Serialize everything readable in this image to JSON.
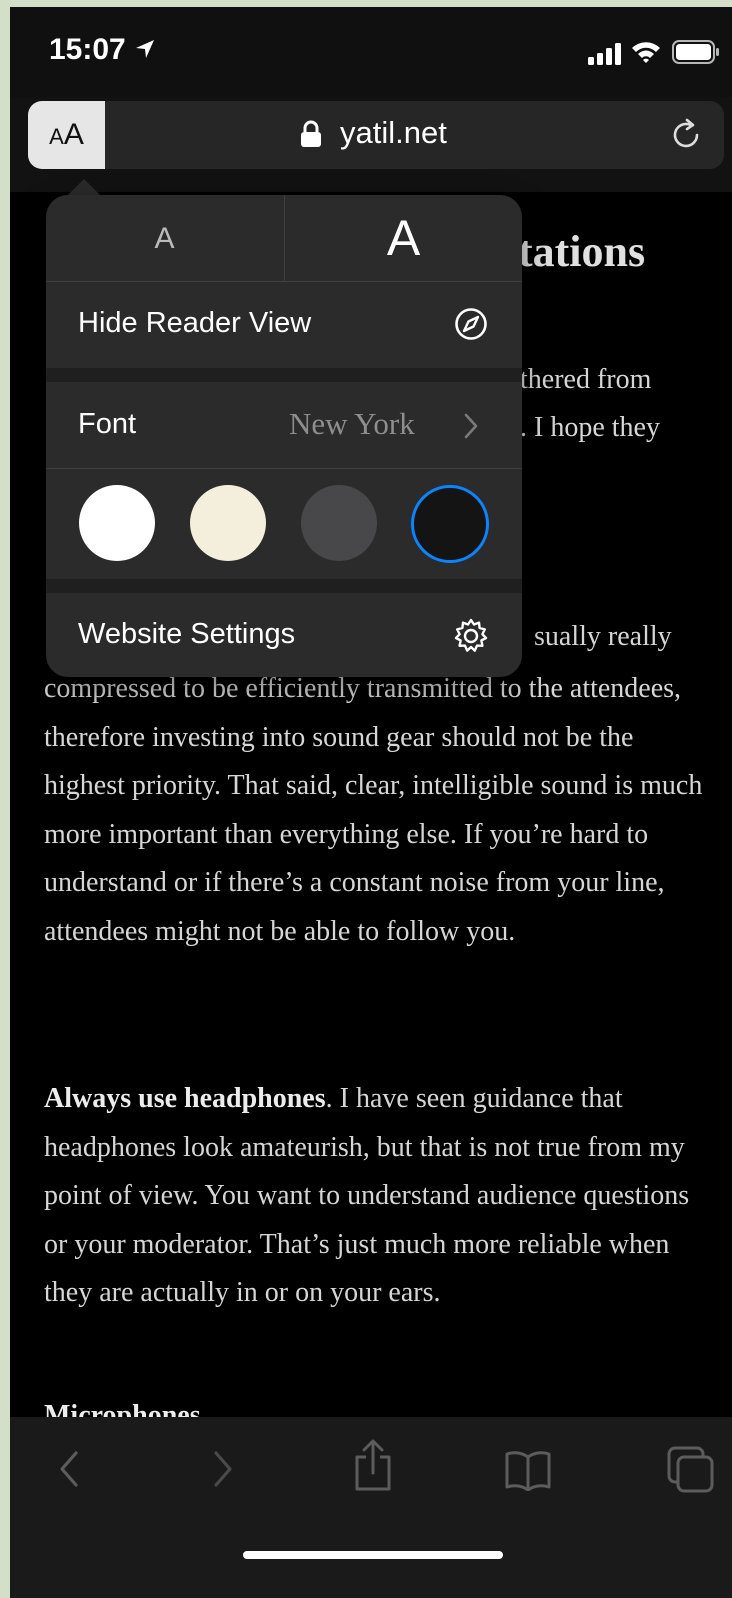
{
  "status_bar": {
    "time": "15:07",
    "icons": [
      "location-arrow-icon",
      "cellular-signal-icon",
      "wifi-icon",
      "battery-icon"
    ]
  },
  "address_bar": {
    "reader_button_label": "AA",
    "url": "yatil.net",
    "icons": [
      "lock-icon",
      "reload-icon"
    ]
  },
  "reader_popover": {
    "smaller_text_label": "A",
    "larger_text_label": "A",
    "hide_reader_view_label": "Hide Reader View",
    "font_label": "Font",
    "font_value": "New York",
    "themes": [
      {
        "name": "white",
        "color": "#ffffff",
        "selected": false
      },
      {
        "name": "sepia",
        "color": "#f4eedd",
        "selected": false
      },
      {
        "name": "gray",
        "color": "#48484b",
        "selected": false
      },
      {
        "name": "black",
        "color": "#141414",
        "selected": true
      }
    ],
    "selected_border_color": "#0a84ff",
    "website_settings_label": "Website Settings"
  },
  "article": {
    "title_fragment": "tations",
    "fragment_line_1": "thered from",
    "fragment_line_2": ". I hope they",
    "fragment_line_3": "sually really",
    "paragraph_1": "compressed to be efficiently transmitted to the attendees, therefore investing into sound gear should not be the highest priority. That said, clear, intelligible sound is much more important than everything else. If you’re hard to understand or if there’s a constant noise from your line, attendees might not be able to follow you.",
    "paragraph_2_bold": "Always use headphones",
    "paragraph_2_rest": ". I have seen guidance that headphones look amateurish, but that is not true from my point of view. You want to understand audience questions or your moderator. That’s just much more reliable when they are actually in or on your ears.",
    "paragraph_3_partial": "Microphones"
  },
  "bottom_toolbar": {
    "icons": [
      "back-icon",
      "forward-icon",
      "share-icon",
      "bookmarks-icon",
      "tabs-icon"
    ]
  }
}
